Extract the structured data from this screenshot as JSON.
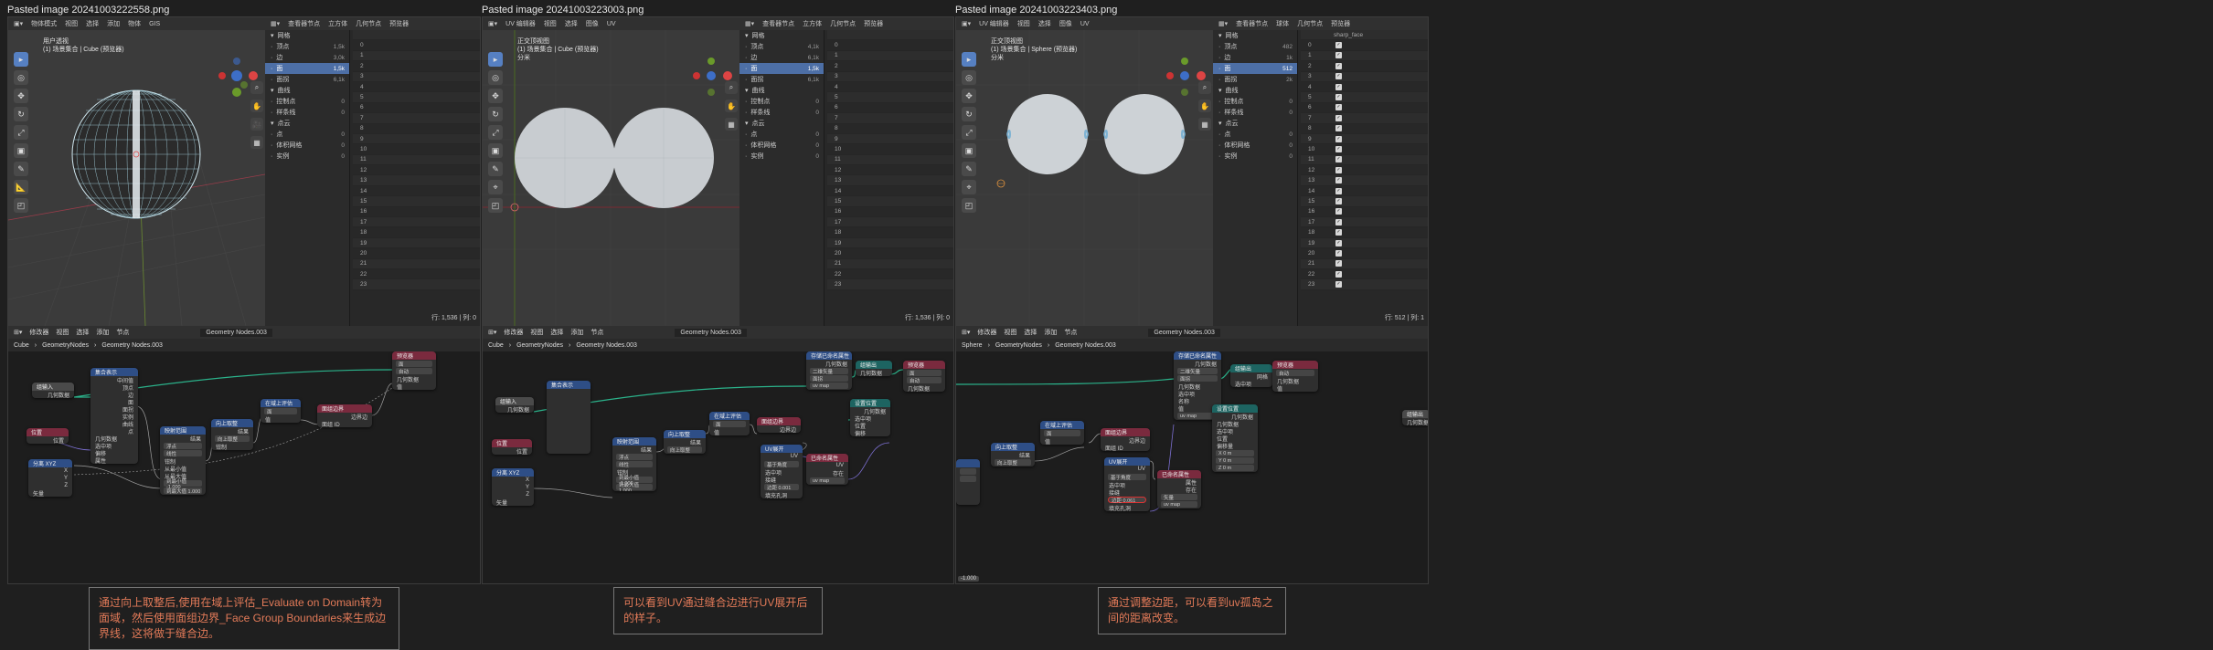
{
  "titles": [
    "Pasted image 20241003222558.png",
    "Pasted image 20241003223003.png",
    "Pasted image 20241003223403.png"
  ],
  "colors": {
    "selected_row": "#4d6fa6",
    "geometry_header": "#2e4e86",
    "input_header": "#7a2a3e",
    "field_header": "#1d6461",
    "caption": "#e27a58",
    "wire_green": "#2bb38b"
  },
  "panels": [
    {
      "viewport_header": [
        "物体模式",
        "视图",
        "选择",
        "添加",
        "物体",
        "GIS"
      ],
      "viewport_info": [
        "用户透视",
        "(1) 场景集合 | Cube (预览器)"
      ],
      "spreadsheet_header": [
        "查看器节点",
        "立方体",
        "几何节点",
        "预览器"
      ],
      "tree": [
        {
          "label": "网格",
          "count": "",
          "sel": false
        },
        {
          "label": "顶点",
          "count": "1,5k",
          "sel": false
        },
        {
          "label": "边",
          "count": "3,0k",
          "sel": false
        },
        {
          "label": "面",
          "count": "1,5k",
          "sel": true
        },
        {
          "label": "面拐",
          "count": "6,1k",
          "sel": false
        },
        {
          "label": "曲线",
          "count": "",
          "sel": false
        },
        {
          "label": "控制点",
          "count": "0",
          "sel": false
        },
        {
          "label": "样条线",
          "count": "0",
          "sel": false
        },
        {
          "label": "点云",
          "count": "",
          "sel": false
        },
        {
          "label": "点",
          "count": "0",
          "sel": false
        },
        {
          "label": "体积网格",
          "count": "0",
          "sel": false
        },
        {
          "label": "实例",
          "count": "0",
          "sel": false
        }
      ],
      "column_header": "",
      "rows": [
        "0",
        "1",
        "2",
        "3",
        "4",
        "5",
        "6",
        "7",
        "8",
        "9",
        "10",
        "11",
        "12",
        "13",
        "14",
        "15",
        "16",
        "17",
        "18",
        "19",
        "20",
        "21",
        "22",
        "23"
      ],
      "footer": "行: 1,536 | 列: 0",
      "node_editor_header": [
        "修改器",
        "视图",
        "选择",
        "添加",
        "节点"
      ],
      "node_group": "Geometry Nodes.003",
      "breadcrumb": [
        "Cube",
        "GeometryNodes",
        "Geometry Nodes.003"
      ],
      "caption": "通过向上取整后,使用在域上评估_Evaluate on Domain转为面域，然后使用面组边界_Face Group Boundaries来生成边界线，这将做于缝合边。"
    },
    {
      "viewport_header": [
        "UV 编辑器",
        "视图",
        "选择",
        "图像",
        "UV"
      ],
      "viewport_info": [
        "正交顶视图",
        "(1) 场景集合 | Cube (预览器)",
        "分米"
      ],
      "spreadsheet_header": [
        "查看器节点",
        "立方体",
        "几何节点",
        "预览器"
      ],
      "tree": [
        {
          "label": "网格",
          "count": "",
          "sel": false
        },
        {
          "label": "顶点",
          "count": "4,1k",
          "sel": false
        },
        {
          "label": "边",
          "count": "6,1k",
          "sel": false
        },
        {
          "label": "面",
          "count": "1,5k",
          "sel": true
        },
        {
          "label": "面拐",
          "count": "6,1k",
          "sel": false
        },
        {
          "label": "曲线",
          "count": "",
          "sel": false
        },
        {
          "label": "控制点",
          "count": "0",
          "sel": false
        },
        {
          "label": "样条线",
          "count": "0",
          "sel": false
        },
        {
          "label": "点云",
          "count": "",
          "sel": false
        },
        {
          "label": "点",
          "count": "0",
          "sel": false
        },
        {
          "label": "体积网格",
          "count": "0",
          "sel": false
        },
        {
          "label": "实例",
          "count": "0",
          "sel": false
        }
      ],
      "column_header": "",
      "rows": [
        "0",
        "1",
        "2",
        "3",
        "4",
        "5",
        "6",
        "7",
        "8",
        "9",
        "10",
        "11",
        "12",
        "13",
        "14",
        "15",
        "16",
        "17",
        "18",
        "19",
        "20",
        "21",
        "22",
        "23"
      ],
      "footer": "行: 1,536 | 列: 0",
      "node_editor_header": [
        "修改器",
        "视图",
        "选择",
        "添加",
        "节点"
      ],
      "node_group": "Geometry Nodes.003",
      "breadcrumb": [
        "Cube",
        "GeometryNodes",
        "Geometry Nodes.003"
      ],
      "caption": "可以看到UV通过缝合边进行UV展开后的样子。"
    },
    {
      "viewport_header": [
        "UV 编辑器",
        "视图",
        "选择",
        "图像",
        "UV"
      ],
      "viewport_info": [
        "正交顶视图",
        "(1) 场景集合 | Sphere (预览器)",
        "分米"
      ],
      "spreadsheet_header": [
        "查看器节点",
        "球体",
        "几何节点",
        "预览器"
      ],
      "tree": [
        {
          "label": "网格",
          "count": "",
          "sel": false
        },
        {
          "label": "顶点",
          "count": "482",
          "sel": false
        },
        {
          "label": "边",
          "count": "1k",
          "sel": false
        },
        {
          "label": "面",
          "count": "512",
          "sel": true
        },
        {
          "label": "面拐",
          "count": "2k",
          "sel": false
        },
        {
          "label": "曲线",
          "count": "",
          "sel": false
        },
        {
          "label": "控制点",
          "count": "0",
          "sel": false
        },
        {
          "label": "样条线",
          "count": "0",
          "sel": false
        },
        {
          "label": "点云",
          "count": "",
          "sel": false
        },
        {
          "label": "点",
          "count": "0",
          "sel": false
        },
        {
          "label": "体积网格",
          "count": "0",
          "sel": false
        },
        {
          "label": "实例",
          "count": "0",
          "sel": false
        }
      ],
      "column_header": "sharp_face",
      "rows": [
        "0",
        "1",
        "2",
        "3",
        "4",
        "5",
        "6",
        "7",
        "8",
        "9",
        "10",
        "11",
        "12",
        "13",
        "14",
        "15",
        "16",
        "17",
        "18",
        "19",
        "20",
        "21",
        "22",
        "23"
      ],
      "footer": "行: 512 | 列: 1",
      "node_editor_header": [
        "修改器",
        "视图",
        "选择",
        "添加",
        "节点"
      ],
      "node_group": "Geometry Nodes.003",
      "breadcrumb": [
        "Sphere",
        "GeometryNodes",
        "Geometry Nodes.003"
      ],
      "caption": "通过调整边距，可以看到uv孤岛之间的距离改变。"
    }
  ],
  "nodes": {
    "p1": [
      {
        "title": "组输入",
        "color": "gray",
        "rows": [
          "几何数据"
        ]
      },
      {
        "title": "集合表示",
        "color": "blue",
        "rows": [
          "中间值",
          "顶点",
          "边",
          "面",
          "面拐",
          "实例",
          "曲线",
          "点",
          "几何数据",
          "选中项",
          "偏移",
          "属性"
        ]
      },
      {
        "title": "位置",
        "color": "red",
        "rows": [
          "位置"
        ]
      },
      {
        "title": "分离 XYZ",
        "color": "blue",
        "rows": [
          "X",
          "Y",
          "Z",
          "矢量"
        ]
      },
      {
        "title": "映射范围",
        "color": "blue",
        "rows": [
          "结果",
          "浮点",
          "线性",
          "钳制",
          "从最小值",
          "从最大值",
          "到最小值 -1.000",
          "到最大值 1.000"
        ]
      },
      {
        "title": "向上取整",
        "color": "blue",
        "rows": [
          "结果",
          "向上取整",
          "钳制"
        ]
      },
      {
        "title": "在域上评估",
        "color": "blue",
        "rows": [
          "面",
          "值"
        ]
      },
      {
        "title": "面组边界",
        "color": "red",
        "rows": [
          "边界边",
          "面组 ID"
        ]
      },
      {
        "title": "预览器",
        "color": "red",
        "rows": [
          "面",
          "自动",
          "几何数据",
          "值"
        ]
      }
    ],
    "p2": [
      {
        "title": "组输入",
        "color": "gray",
        "rows": [
          "几何数据"
        ]
      },
      {
        "title": "位置",
        "color": "red",
        "rows": [
          "位置"
        ]
      },
      {
        "title": "分离 XYZ",
        "color": "blue",
        "rows": [
          "X",
          "Y",
          "Z",
          "矢量"
        ]
      },
      {
        "title": "映射范围",
        "color": "blue",
        "rows": [
          "结果",
          "浮点",
          "线性",
          "钳制",
          "到最小值 -1.000",
          "到最大值 1.000"
        ]
      },
      {
        "title": "向上取整",
        "color": "blue",
        "rows": [
          "结果",
          "向上取整"
        ]
      },
      {
        "title": "在域上评估",
        "color": "blue",
        "rows": [
          "面",
          "值"
        ]
      },
      {
        "title": "面组边界",
        "color": "red",
        "rows": [
          "边界边"
        ]
      },
      {
        "title": "UV展开",
        "color": "blue",
        "rows": [
          "UV",
          "基于角度",
          "选中项",
          "接缝",
          "边距 0.001",
          "填充孔洞"
        ]
      },
      {
        "title": "已命名属性",
        "color": "red",
        "rows": [
          "UV",
          "存在",
          "uv map"
        ]
      },
      {
        "title": "存储已命名属性",
        "color": "blue",
        "rows": [
          "几何数据",
          "二维矢量",
          "面拐",
          "uv map"
        ]
      },
      {
        "title": "设置位置",
        "color": "teal",
        "rows": [
          "几何数据",
          "选中项",
          "位置",
          "偏移"
        ]
      },
      {
        "title": "预览器",
        "color": "red",
        "rows": [
          "面",
          "自动",
          "几何数据"
        ]
      },
      {
        "title": "组输出",
        "color": "teal",
        "rows": [
          "几何数据"
        ]
      }
    ],
    "p3": [
      {
        "title": "向上取整",
        "color": "blue",
        "rows": [
          "结果",
          "向上取整"
        ]
      },
      {
        "title": "在域上评估",
        "color": "blue",
        "rows": [
          "面",
          "值"
        ]
      },
      {
        "title": "面组边界",
        "color": "red",
        "rows": [
          "边界边",
          "面组 ID"
        ]
      },
      {
        "title": "UV展开",
        "color": "blue",
        "rows": [
          "UV",
          "基于角度",
          "选中项",
          "接缝",
          "边距 0.061",
          "填充孔洞"
        ]
      },
      {
        "title": "已命名属性",
        "color": "red",
        "rows": [
          "属性",
          "存在",
          "矢量",
          "uv map"
        ]
      },
      {
        "title": "存储已命名属性",
        "color": "blue",
        "rows": [
          "几何数据",
          "二维矢量",
          "面拐",
          "几何数据",
          "选中项",
          "名称",
          "值",
          "uv map"
        ]
      },
      {
        "title": "组输出",
        "color": "teal",
        "rows": [
          "网格",
          "选中项"
        ]
      },
      {
        "title": "设置位置",
        "color": "teal",
        "rows": [
          "几何数据",
          "几何数据",
          "选中项",
          "位置",
          "偏移量",
          "X 0 m",
          "Y 0 m",
          "Z 0 m"
        ]
      },
      {
        "title": "预览器",
        "color": "red",
        "rows": [
          "自动",
          "几何数据",
          "值"
        ]
      },
      {
        "title": "组输出",
        "color": "gray",
        "rows": [
          "几何数据"
        ]
      }
    ]
  },
  "labels": {
    "margin_value": "-1.000"
  }
}
